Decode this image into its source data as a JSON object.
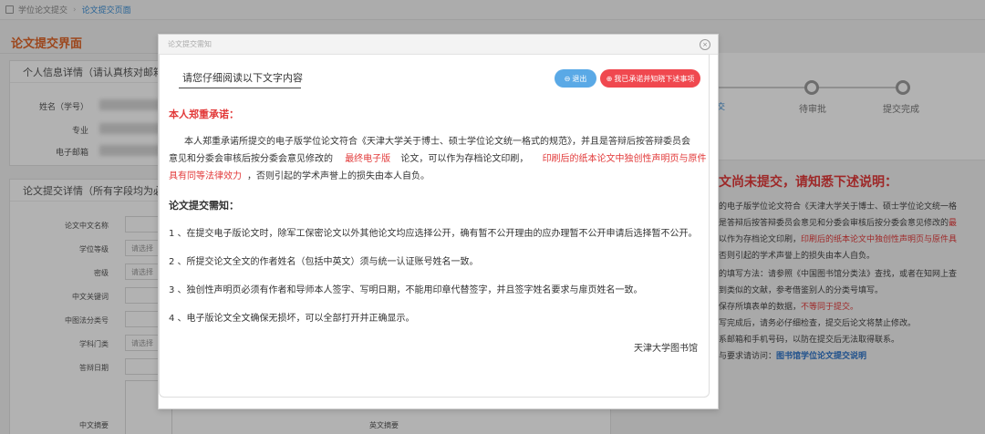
{
  "breadcrumb": {
    "item1": "学位论文提交",
    "item2": "论文提交页面"
  },
  "page": {
    "title": "论文提交界面"
  },
  "personal": {
    "header": "个人信息详情（请认真核对邮箱及",
    "fields": [
      {
        "label": "姓名（学号）"
      },
      {
        "label": "专业"
      },
      {
        "label": "电子邮箱"
      }
    ]
  },
  "form": {
    "header": "论文提交详情（所有字段均为必填",
    "fields": [
      {
        "label": "论文中文名称",
        "value": ""
      },
      {
        "label": "学位等级",
        "value": "请选择"
      },
      {
        "label": "密级",
        "value": "请选择"
      },
      {
        "label": "中文关键词",
        "value": ""
      },
      {
        "label": "中图法分类号",
        "value": ""
      },
      {
        "label": "学科门类",
        "value": "请选择"
      },
      {
        "label": "答辩日期",
        "value": ""
      },
      {
        "label": "中文摘要",
        "value": ""
      }
    ],
    "english_abstract_label": "英文摘要"
  },
  "progress": {
    "step_pending": "待审批",
    "step_done": "提交完成",
    "partial_text": "交"
  },
  "right_notice": {
    "warning": "文尚未提交，请知悉下述说明：",
    "lines": [
      "的电子版学位论文符合《天津大学关于博士、硕士学位论文统一格",
      "是答辩后按答辩委员会意见和分委会审核后按分委会意见修改的",
      "以作为存档论文印刷，",
      "否则引起的学术声誉上的损失由本人自负。",
      "的填写方法：请参照《中国图书馆分类法》查找，或者在知网上查",
      "到类似的文献，参考借鉴别人的分类号填写。",
      "保存所填表单的数据，",
      "写完成后，请务必仔细检查，提交后论文将禁止修改。",
      "系邮箱和手机号码，以防在提交后无法取得联系。",
      "与要求请访问："
    ],
    "red_part1": "最",
    "red_part2": "印刷后的纸本论文中独创性声明页与原件具",
    "red_part3": "不等同于提交。",
    "link": "图书馆学位论文提交说明"
  },
  "modal": {
    "title": "论文提交需知",
    "notice_label": "请您仔细阅读以下文字内容",
    "exit_button": "退出",
    "accept_button": "我已承诺并知晓下述事项",
    "pledge_heading": "本人郑重承诺：",
    "para1_a": "本人郑重承诺所提交的电子版学位论文符合《天津大学关于博士、硕士学位论文统一格式的规范》，并且是答辩后按答辩委员会",
    "para1_b": "意见和分委会审核后按分委会意见修改的",
    "para1_red1": "最终电子版",
    "para1_c": "论文，可以作为存档论文印刷，",
    "para1_red2": "印刷后的纸本论文中独创性声明页与原件",
    "para1_red3": "具有同等法律效力",
    "para1_d": "，否则引起的学术声誉上的损失由本人自负。",
    "notes_heading": "论文提交需知：",
    "notes": [
      "1 、在提交电子版论文时，除军工保密论文以外其他论文均应选择公开，确有暂不公开理由的应办理暂不公开申请后选择暂不公开。",
      "2 、所提交论文全文的作者姓名（包括中英文）须与统一认证账号姓名一致。",
      "3 、独创性声明页必须有作者和导师本人签字、写明日期，不能用印章代替签字，并且签字姓名要求与扉页姓名一致。",
      "4 、电子版论文全文确保无损坏，可以全部打开并正确显示。"
    ],
    "signature": "天津大学图书馆"
  }
}
